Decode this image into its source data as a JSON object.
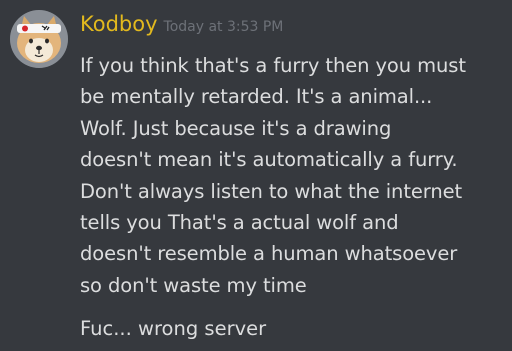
{
  "message": {
    "author": "Kodboy",
    "timestamp": "Today at 3:53 PM",
    "author_color": "#e2b91e",
    "avatar_icon": "shiba-dog-headband-avatar",
    "body_lines": [
      "If you think that's a furry then you must",
      "be mentally retarded. It's a animal...",
      "Wolf. Just because it's a drawing",
      "doesn't mean it's automatically a furry.",
      "Don't always listen to what the internet",
      "tells you That's a actual wolf and",
      "doesn't resemble a human whatsoever",
      "so don't waste my time"
    ],
    "followup": "Fuc... wrong server"
  }
}
